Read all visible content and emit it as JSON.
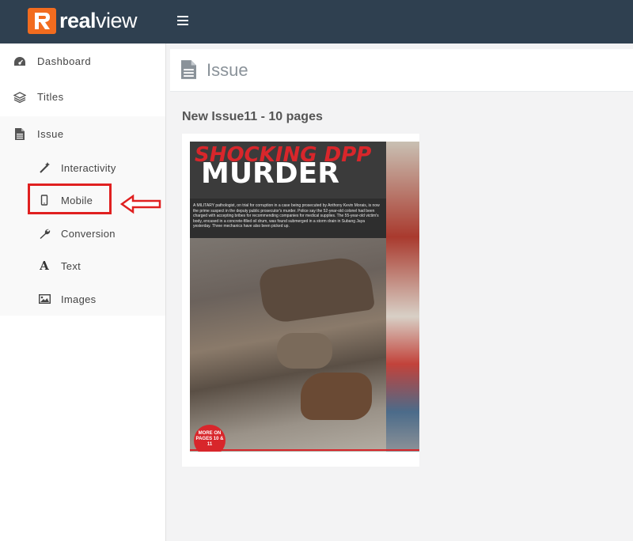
{
  "topbar": {
    "brand_bold": "real",
    "brand_light": "view"
  },
  "sidebar": {
    "items": [
      {
        "label": "Dashboard",
        "icon": "dashboard-icon"
      },
      {
        "label": "Titles",
        "icon": "layers-icon"
      },
      {
        "label": "Issue",
        "icon": "file-icon"
      }
    ],
    "sub_items": [
      {
        "label": "Interactivity",
        "icon": "magic-wand-icon"
      },
      {
        "label": "Mobile",
        "icon": "mobile-icon"
      },
      {
        "label": "Conversion",
        "icon": "wrench-icon"
      },
      {
        "label": "Text",
        "icon": "font-icon"
      },
      {
        "label": "Images",
        "icon": "image-icon"
      }
    ]
  },
  "page": {
    "title": "Issue",
    "issue_heading": "New Issue11 - 10 pages"
  },
  "cover": {
    "headline_top": "SHOCKING DPP",
    "headline_main": "MURDER",
    "body": "A MILITARY pathologist, on trial for corruption in a case being prosecuted by Anthony Kevin Morais, is now the prime suspect in the deputy public prosecutor's murder. Police say the 52-year-old colonel had been charged with accepting bribes for recommending companies for medical supplies. The 55-year-old victim's body, encased in a concrete-filled oil drum, was found submerged in a storm drain in Subang Jaya yesterday. Three mechanics have also been picked up.",
    "badge": "MORE ON PAGES 10 & 11"
  },
  "colors": {
    "topbar": "#2f4050",
    "brand_orange": "#f26c1f",
    "highlight_red": "#e02020"
  }
}
